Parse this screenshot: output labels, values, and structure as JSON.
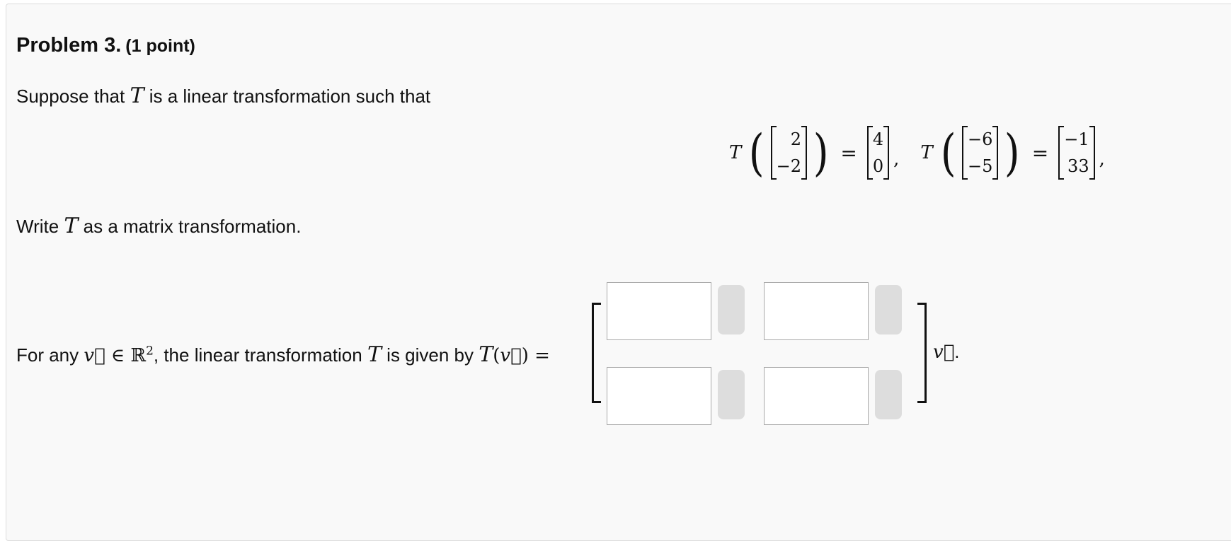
{
  "problem": {
    "title": "Problem 3.",
    "points": "(1 point)"
  },
  "intro": {
    "before": "Suppose that ",
    "var": "T",
    "after": " is a linear transformation such that"
  },
  "given": {
    "T": "T",
    "eq": "=",
    "v1": [
      "2",
      "−2"
    ],
    "w1": [
      "4",
      "0"
    ],
    "v2": [
      "−6",
      "−5"
    ],
    "w2": [
      "−1",
      "33"
    ],
    "sep": ",",
    "end": ","
  },
  "instruction": {
    "before": "Write ",
    "var": "T",
    "after": " as a matrix transformation."
  },
  "answer_line": {
    "p1": "For any ",
    "v": "v⃗",
    "in": " ∈ ",
    "R": "ℝ",
    "sup": "2",
    "p2": ", the linear transformation ",
    "T": "T",
    "p3": " is given by ",
    "Tv": "T",
    "open": "(",
    "v2": "v⃗",
    "close": ")",
    "eq": " =",
    "tail_v": "v⃗",
    "tail_dot": "."
  },
  "matrix_inputs": [
    {
      "row": 1,
      "col": 1,
      "value": ""
    },
    {
      "row": 1,
      "col": 2,
      "value": ""
    },
    {
      "row": 2,
      "col": 1,
      "value": ""
    },
    {
      "row": 2,
      "col": 2,
      "value": ""
    }
  ]
}
